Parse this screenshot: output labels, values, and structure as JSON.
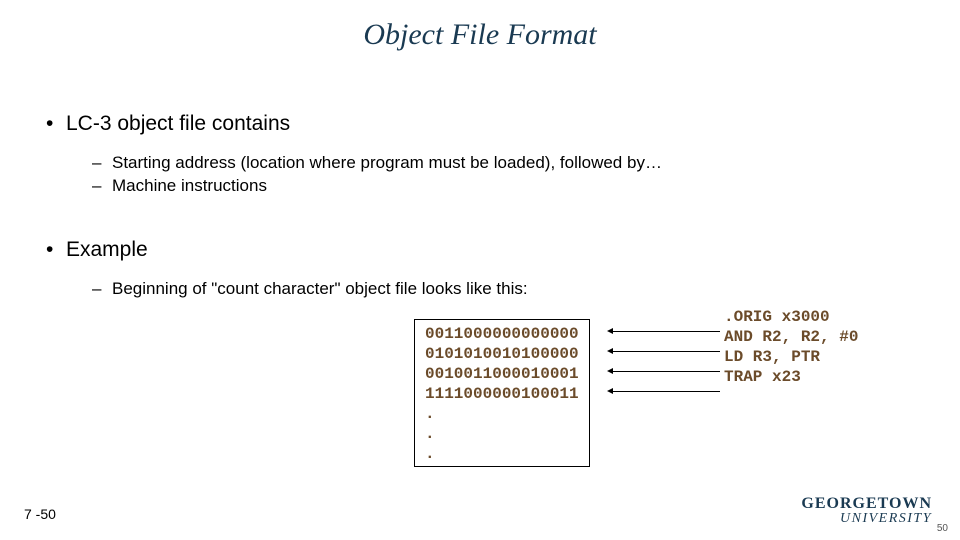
{
  "title": "Object File Format",
  "section1": {
    "heading": "LC-3 object file contains",
    "items": [
      "Starting address (location where program must be loaded), followed by…",
      "Machine instructions"
    ]
  },
  "section2": {
    "heading": "Example",
    "intro": "Beginning of \"count character\" object file looks like this:",
    "obj_lines": [
      "0011000000000000",
      "0101010010100000",
      "0010011000010001",
      "1111000000100011",
      ".",
      ".",
      "."
    ],
    "annotations": [
      ".ORIG x3000",
      "AND R2, R2, #0",
      "LD R3, PTR",
      "TRAP x23"
    ]
  },
  "footer": {
    "slide": "7 -50",
    "page": "50",
    "logo_top": "GEORGETOWN",
    "logo_bot": "UNIVERSITY"
  }
}
